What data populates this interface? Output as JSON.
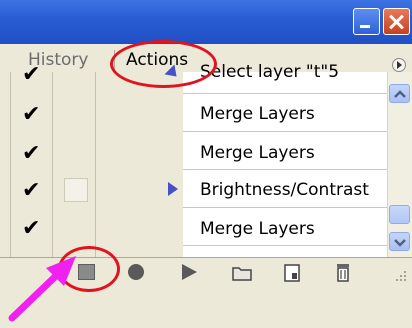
{
  "tabs": [
    {
      "label": "History",
      "active": false
    },
    {
      "label": "Actions",
      "active": true
    }
  ],
  "actions": [
    {
      "label": "Select layer \"t\"5",
      "checked": true,
      "has_dialog": false,
      "expand_arrow": true
    },
    {
      "label": "Merge Layers",
      "checked": true,
      "has_dialog": false,
      "expand_arrow": false
    },
    {
      "label": "Merge Layers",
      "checked": true,
      "has_dialog": false,
      "expand_arrow": false
    },
    {
      "label": "Brightness/Contrast",
      "checked": true,
      "has_dialog": true,
      "expand_arrow": true
    },
    {
      "label": "Merge Layers",
      "checked": true,
      "has_dialog": false,
      "expand_arrow": false
    }
  ],
  "toolbar": [
    "stop-icon",
    "record-icon",
    "play-icon",
    "new-set-icon",
    "new-action-icon",
    "delete-icon"
  ],
  "colors": {
    "titlebar": "#2a5dd4",
    "panel": "#ece9d8",
    "annotation_circle": "#e0141e",
    "annotation_arrow": "#f020f0"
  }
}
